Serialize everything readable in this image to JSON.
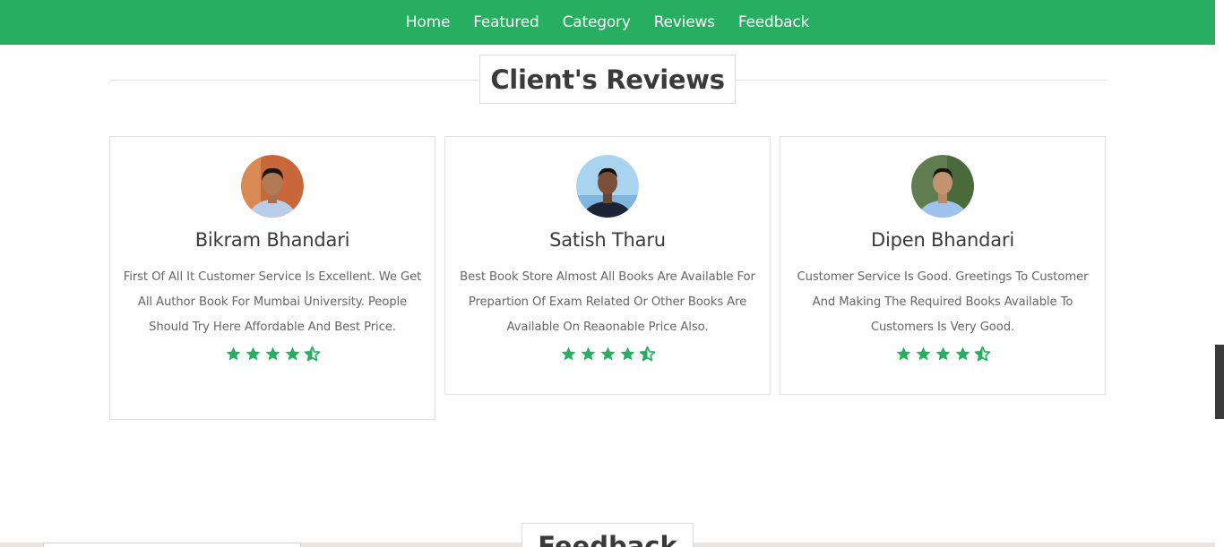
{
  "nav": {
    "items": [
      "Home",
      "Featured",
      "Category",
      "Reviews",
      "Feedback"
    ],
    "background": "#27ae60"
  },
  "reviews": {
    "heading": "Client's Reviews",
    "star_color": "#27ae60",
    "cards": [
      {
        "name": "Bikram Bhandari",
        "text": "First Of All It Customer Service Is Excellent. We Get All Author Book For Mumbai University. People Should Try Here Affordable And Best Price.",
        "rating": 4.5,
        "avatar": "person-avatar-orange-background"
      },
      {
        "name": "Satish Tharu",
        "text": "Best Book Store Almost All Books Are Available For Prepartion Of Exam Related Or Other Books Are Available On Reaonable Price Also.",
        "rating": 4.5,
        "avatar": "person-avatar-sky-background"
      },
      {
        "name": "Dipen Bhandari",
        "text": "Customer Service Is Good. Greetings To Customer And Making The Required Books Available To Customers Is Very Good.",
        "rating": 4.5,
        "avatar": "person-avatar-green-background"
      }
    ]
  },
  "feedback": {
    "heading": "Feedback"
  }
}
